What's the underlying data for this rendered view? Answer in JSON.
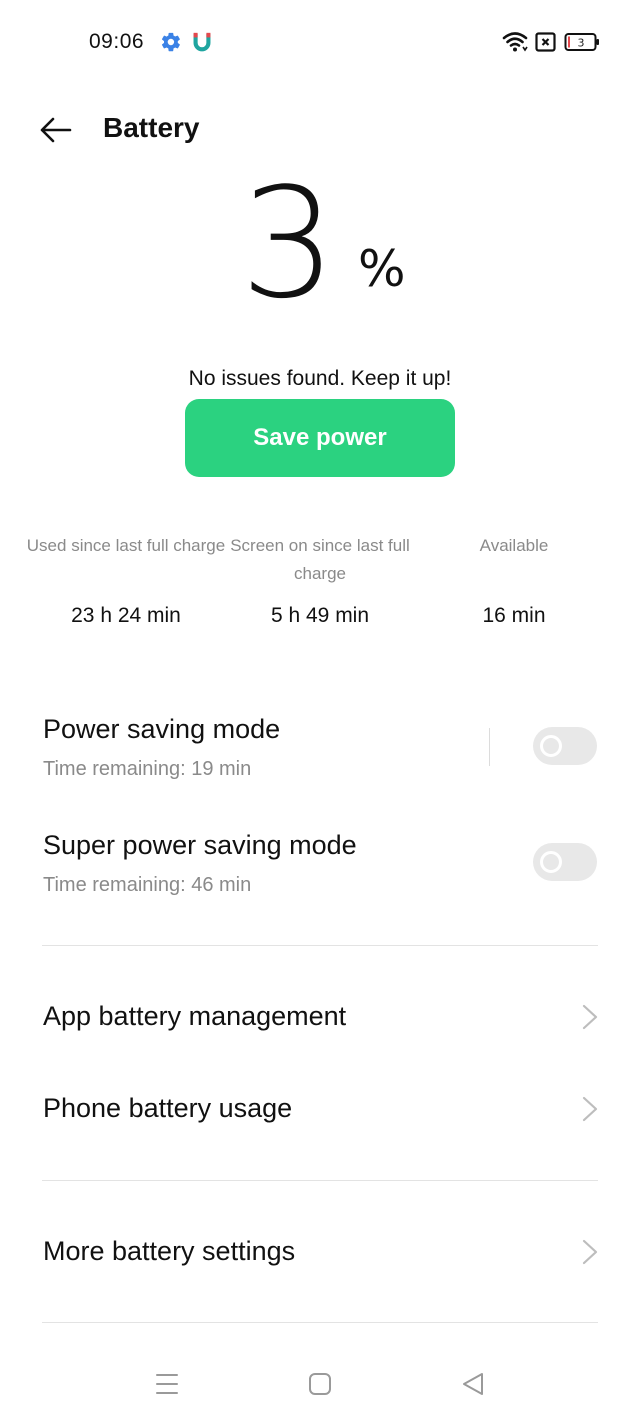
{
  "status_bar": {
    "time": "09:06",
    "battery_level": "3",
    "icons": [
      "gear-icon",
      "magnet-icon",
      "wifi-icon",
      "no-sim-icon",
      "battery-icon"
    ]
  },
  "header": {
    "title": "Battery",
    "back_icon": "arrow-left-icon"
  },
  "battery": {
    "percent": "3",
    "percent_sign": "%",
    "status_message": "No issues found. Keep it up!",
    "save_button": "Save power"
  },
  "stats": [
    {
      "label": "Used since last full charge",
      "value": "23 h 24 min"
    },
    {
      "label": "Screen on since last full charge",
      "value": "5 h 49 min"
    },
    {
      "label": "Available",
      "value": "16 min"
    }
  ],
  "modes": {
    "power_saving": {
      "title": "Power saving mode",
      "subtitle": "Time remaining:  19 min",
      "enabled": false
    },
    "super_power_saving": {
      "title": "Super power saving mode",
      "subtitle": "Time remaining:  46 min",
      "enabled": false
    }
  },
  "links": {
    "app_battery": "App battery management",
    "phone_usage": "Phone battery usage",
    "more_settings": "More battery settings"
  },
  "nav_bar": {
    "icons": [
      "menu-icon",
      "home-icon",
      "back-icon"
    ]
  },
  "colors": {
    "accent": "#2bd280",
    "toggle_off": "#e8e8e8",
    "secondary_text": "#8a8a8a"
  }
}
